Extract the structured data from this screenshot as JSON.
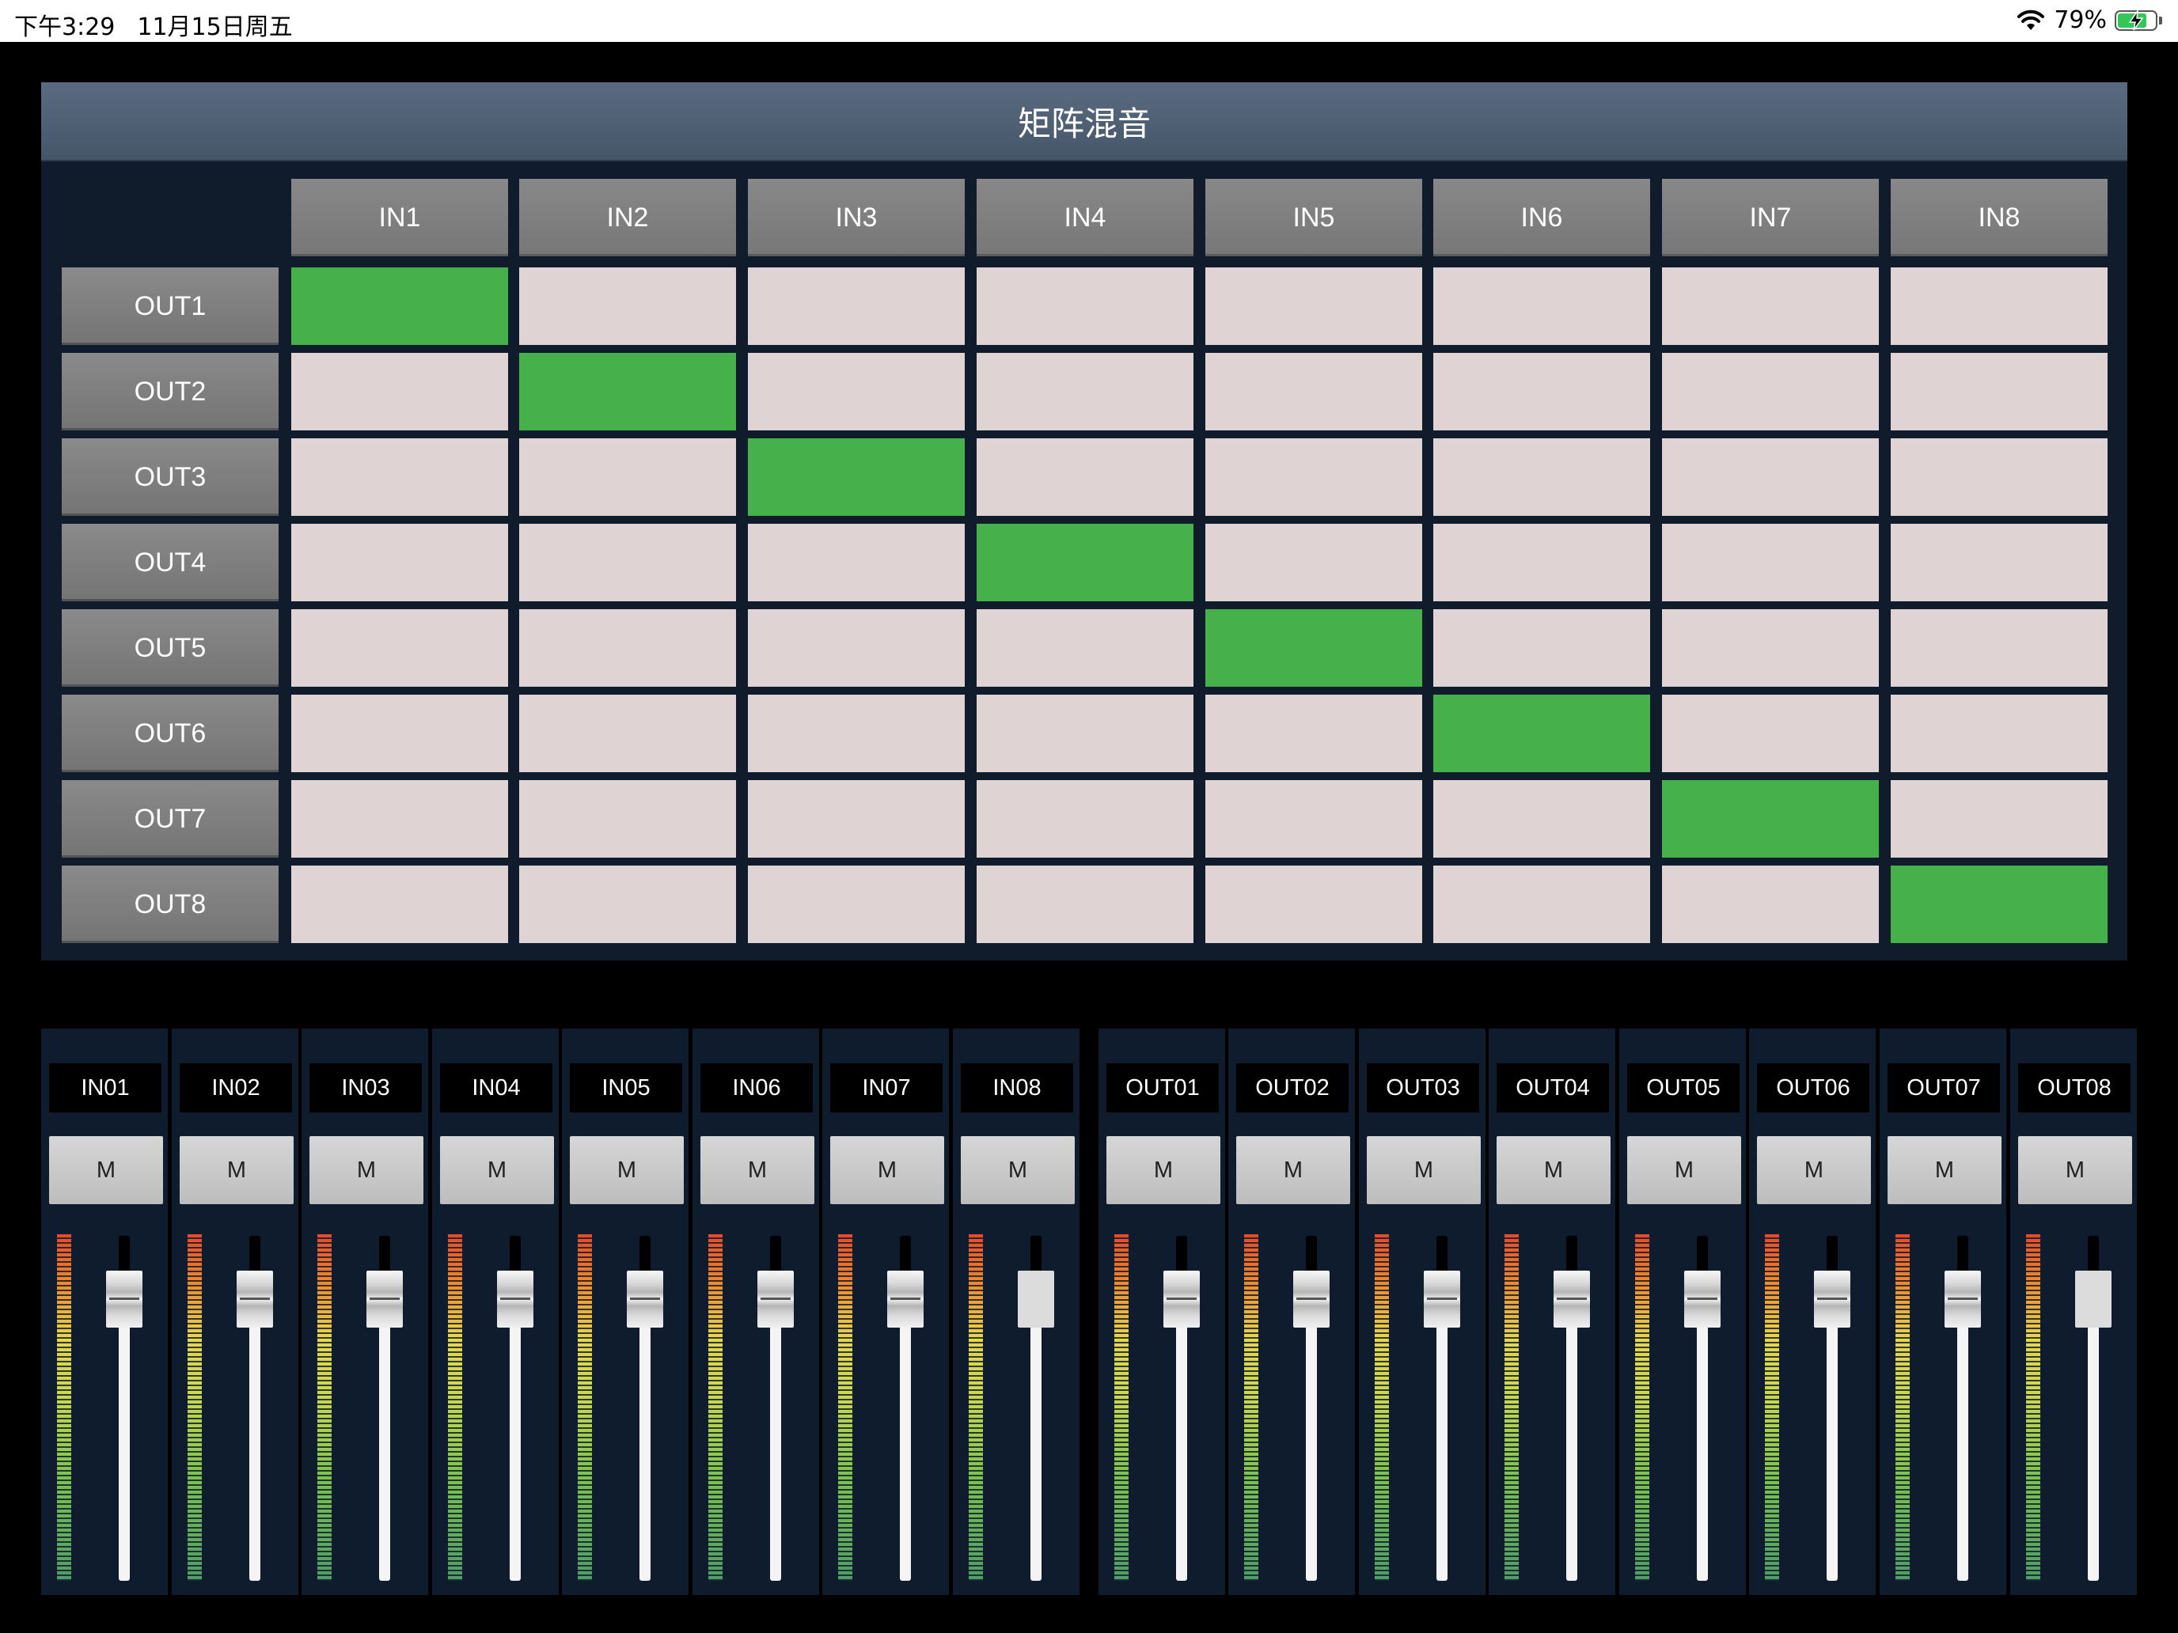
{
  "status_bar": {
    "time": "下午3:29",
    "date": "11月15日周五",
    "battery": "79%",
    "battery_level": 0.79
  },
  "matrix": {
    "title": "矩阵混音",
    "inputs": [
      "IN1",
      "IN2",
      "IN3",
      "IN4",
      "IN5",
      "IN6",
      "IN7",
      "IN8"
    ],
    "outputs": [
      "OUT1",
      "OUT2",
      "OUT3",
      "OUT4",
      "OUT5",
      "OUT6",
      "OUT7",
      "OUT8"
    ],
    "routing": [
      [
        1,
        0,
        0,
        0,
        0,
        0,
        0,
        0
      ],
      [
        0,
        1,
        0,
        0,
        0,
        0,
        0,
        0
      ],
      [
        0,
        0,
        1,
        0,
        0,
        0,
        0,
        0
      ],
      [
        0,
        0,
        0,
        1,
        0,
        0,
        0,
        0
      ],
      [
        0,
        0,
        0,
        0,
        1,
        0,
        0,
        0
      ],
      [
        0,
        0,
        0,
        0,
        0,
        1,
        0,
        0
      ],
      [
        0,
        0,
        0,
        0,
        0,
        0,
        1,
        0
      ],
      [
        0,
        0,
        0,
        0,
        0,
        0,
        0,
        1
      ]
    ],
    "colors": {
      "active": "#46b04a",
      "inactive": "#e0d3d3"
    }
  },
  "mixer": {
    "mute_label": "M",
    "channels": [
      {
        "name": "IN01",
        "fader_level": 0.88,
        "selected": false
      },
      {
        "name": "IN02",
        "fader_level": 0.88,
        "selected": false
      },
      {
        "name": "IN03",
        "fader_level": 0.88,
        "selected": false
      },
      {
        "name": "IN04",
        "fader_level": 0.88,
        "selected": false
      },
      {
        "name": "IN05",
        "fader_level": 0.88,
        "selected": false
      },
      {
        "name": "IN06",
        "fader_level": 0.88,
        "selected": false
      },
      {
        "name": "IN07",
        "fader_level": 0.88,
        "selected": false
      },
      {
        "name": "IN08",
        "fader_level": 0.88,
        "selected": true
      },
      {
        "name": "OUT01",
        "fader_level": 0.88,
        "selected": false
      },
      {
        "name": "OUT02",
        "fader_level": 0.88,
        "selected": false
      },
      {
        "name": "OUT03",
        "fader_level": 0.88,
        "selected": false
      },
      {
        "name": "OUT04",
        "fader_level": 0.88,
        "selected": false
      },
      {
        "name": "OUT05",
        "fader_level": 0.88,
        "selected": false
      },
      {
        "name": "OUT06",
        "fader_level": 0.88,
        "selected": false
      },
      {
        "name": "OUT07",
        "fader_level": 0.88,
        "selected": false
      },
      {
        "name": "OUT08",
        "fader_level": 0.88,
        "selected": true
      }
    ]
  }
}
